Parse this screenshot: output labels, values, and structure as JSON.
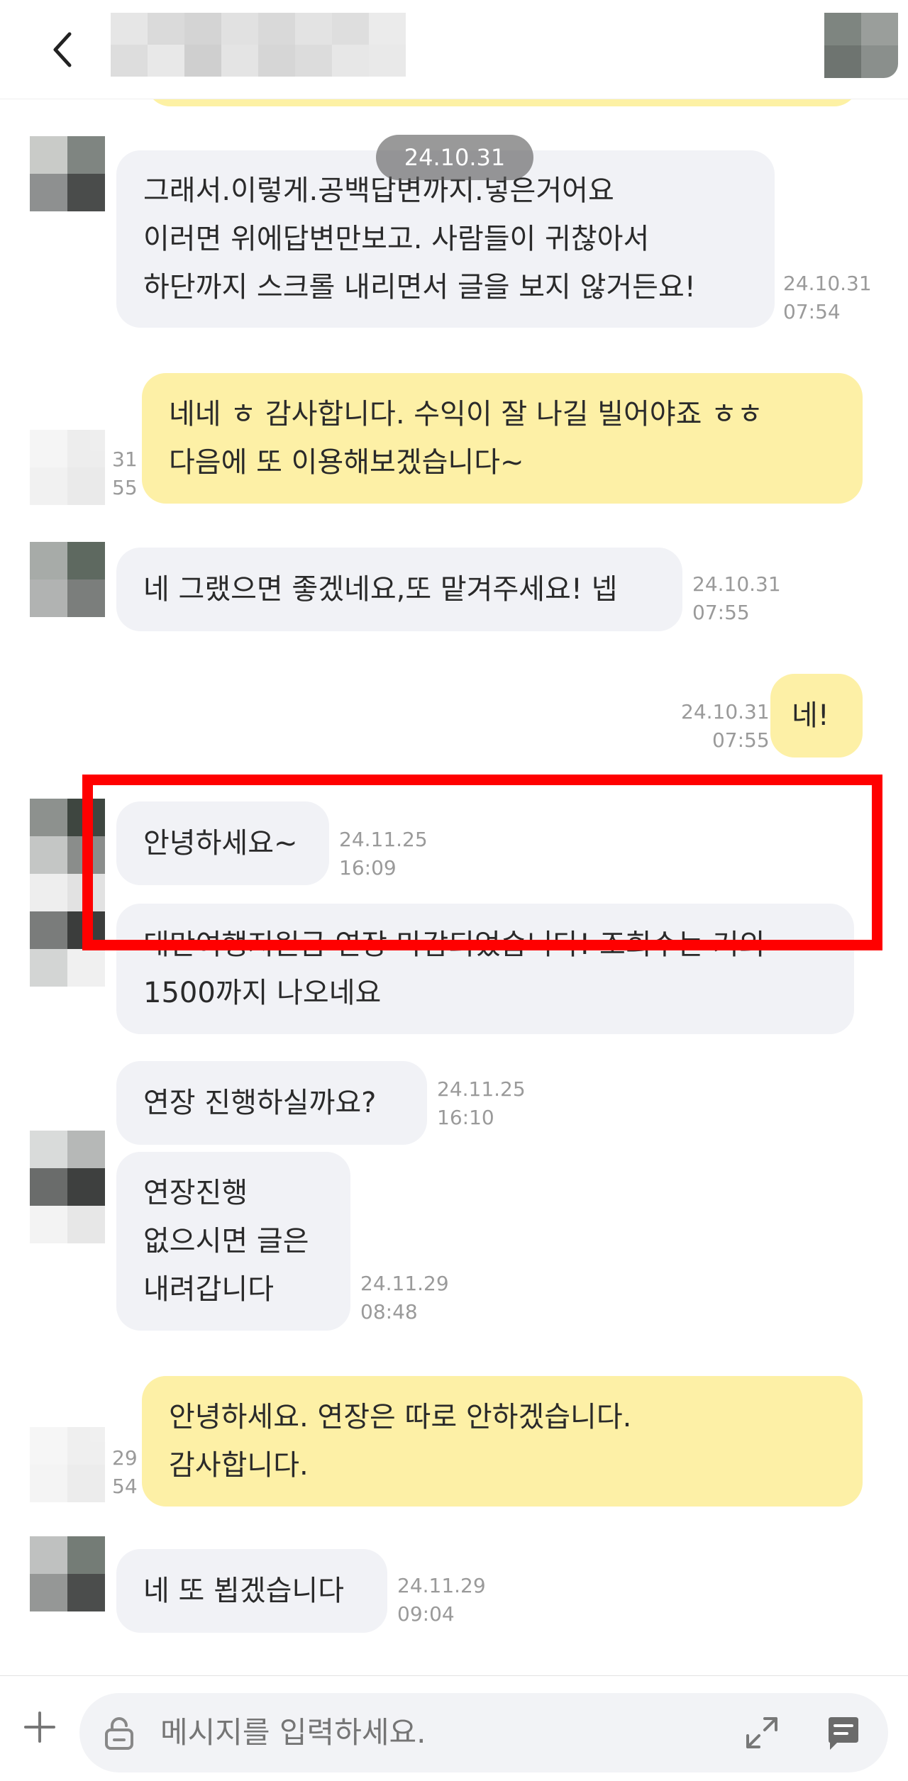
{
  "header": {
    "back_icon": "chevron-left-icon"
  },
  "date_divider": "24.10.31",
  "peek_time": "…",
  "messages": [
    {
      "dir": "in",
      "lines": [
        "그래서.이렇게.공백답변까지.넣은거어요",
        "이러면 위에답변만보고. 사람들이 귀찮아서",
        "하단까지 스크롤 내리면서 글을 보지 않거든요!"
      ],
      "date": "24.10.31",
      "time": "07:54"
    },
    {
      "dir": "out",
      "lines": [
        "네네 ㅎ 감사합니다. 수익이 잘 나길 빌어야죠 ㅎㅎ",
        "다음에 또 이용해보겠습니다~"
      ],
      "date": "31",
      "time": "55"
    },
    {
      "dir": "in",
      "lines": [
        "네 그랬으면 좋겠네요,또 맡겨주세요! 넵"
      ],
      "date": "24.10.31",
      "time": "07:55"
    },
    {
      "dir": "out",
      "lines": [
        "네!"
      ],
      "date": "24.10.31",
      "time": "07:55"
    },
    {
      "dir": "in",
      "lines": [
        "안녕하세요~"
      ],
      "date": "24.11.25",
      "time": "16:09"
    },
    {
      "dir": "in",
      "lines": [
        "대만여행지원금 연장 마감되었습니다! 조회수는 거의",
        "1500까지 나오네요"
      ]
    },
    {
      "dir": "in",
      "lines": [
        "연장 진행하실까요?"
      ],
      "date": "24.11.25",
      "time": "16:10"
    },
    {
      "dir": "in",
      "lines": [
        "연장진행",
        "없으시면 글은",
        "내려갑니다"
      ],
      "date": "24.11.29",
      "time": "08:48"
    },
    {
      "dir": "out",
      "lines": [
        "안녕하세요. 연장은 따로 안하겠습니다.",
        "감사합니다."
      ],
      "date": "29",
      "time": "54"
    },
    {
      "dir": "in",
      "lines": [
        "네 또 뵙겠습니다"
      ],
      "date": "24.11.29",
      "time": "09:04"
    }
  ],
  "composer": {
    "placeholder": "메시지를 입력하세요.",
    "plus_icon": "plus-icon",
    "lock_icon": "lock-icon",
    "expand_icon": "expand-icon",
    "send_icon": "chat-send-icon"
  },
  "colors": {
    "incoming_bubble": "#f1f2f6",
    "outgoing_bubble": "#fdf0a6",
    "highlight_box": "#ff0000",
    "date_pill": "#5a5a5a"
  }
}
